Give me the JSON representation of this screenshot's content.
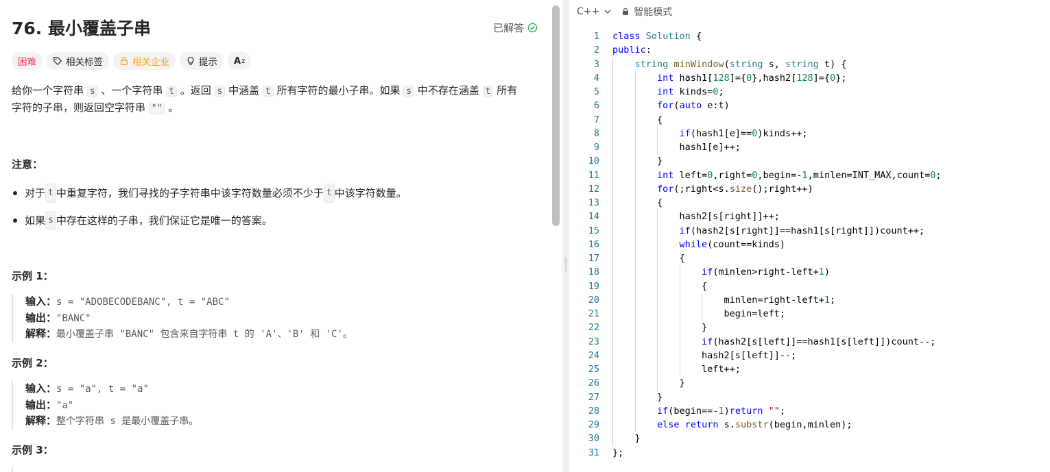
{
  "problem": {
    "title": "76. 最小覆盖子串",
    "status": "已解答",
    "tags": {
      "difficulty": "困难",
      "related_tags": "相关标签",
      "related_companies": "相关企业",
      "hint": "提示",
      "translate": "A"
    },
    "description": {
      "line1_p1": "给你一个字符串 ",
      "code_s": "s",
      "line1_p2": " 、一个字符串 ",
      "code_t": "t",
      "line1_p3": " 。返回 ",
      "line1_p4": " 中涵盖 ",
      "line1_p5": " 所有字符的最小子串。如果 ",
      "line1_p6": " 中不存在涵盖 ",
      "line1_p7": " 所有",
      "line2_p1": "字符的子串，则返回空字符串 ",
      "code_empty": "\"\"",
      "line2_p2": " 。"
    },
    "note_heading": "注意：",
    "notes": {
      "n1_p1": "对于 ",
      "n1_p2": " 中重复字符，我们寻找的子字符串中该字符数量必须不少于 ",
      "n1_p3": " 中该字符数量。",
      "n2_p1": "如果 ",
      "n2_p2": " 中存在这样的子串，我们保证它是唯一的答案。"
    },
    "labels": {
      "input": "输入：",
      "output": "输出：",
      "explain": "解释："
    },
    "examples": [
      {
        "heading": "示例 1：",
        "input": "s = \"ADOBECODEBANC\", t = \"ABC\"",
        "output": "\"BANC\"",
        "explain": "最小覆盖子串 \"BANC\" 包含来自字符串 t 的 'A'、'B' 和 'C'。"
      },
      {
        "heading": "示例 2：",
        "input": "s = \"a\", t = \"a\"",
        "output": "\"a\"",
        "explain": "整个字符串 s 是最小覆盖子串。"
      },
      {
        "heading": "示例 3："
      }
    ]
  },
  "editor": {
    "language": "C++",
    "mode": "智能模式",
    "line_numbers": [
      "1",
      "2",
      "3",
      "4",
      "5",
      "6",
      "7",
      "8",
      "9",
      "10",
      "11",
      "12",
      "13",
      "14",
      "15",
      "16",
      "17",
      "18",
      "19",
      "20",
      "21",
      "22",
      "23",
      "24",
      "25",
      "26",
      "27",
      "28",
      "29",
      "30",
      "31"
    ],
    "code_lines": [
      "class Solution {",
      "public:",
      "    string minWindow(string s, string t) {",
      "        int hash1[128]={0},hash2[128]={0};",
      "        int kinds=0;",
      "        for(auto e:t)",
      "        {",
      "            if(hash1[e]==0)kinds++;",
      "            hash1[e]++;",
      "        }",
      "        int left=0,right=0,begin=-1,minlen=INT_MAX,count=0;",
      "        for(;right<s.size();right++)",
      "        {",
      "            hash2[s[right]]++;",
      "            if(hash2[s[right]]==hash1[s[right]])count++;",
      "            while(count==kinds)",
      "            {",
      "                if(minlen>right-left+1)",
      "                {",
      "                    minlen=right-left+1;",
      "                    begin=left;",
      "                }",
      "                if(hash2[s[left]]==hash1[s[left]])count--;",
      "                hash2[s[left]]--;",
      "                left++;",
      "            }",
      "        }",
      "        if(begin==-1)return \"\";",
      "        else return s.substr(begin,minlen);",
      "    }",
      "};"
    ]
  },
  "colors": {
    "keyword": "#0000ff",
    "type": "#267f99",
    "number": "#098658",
    "string": "#a31515",
    "function": "#795e26",
    "difficulty_hard": "#ff2d55",
    "company": "#ffa116",
    "solved_check": "#2db55d"
  }
}
